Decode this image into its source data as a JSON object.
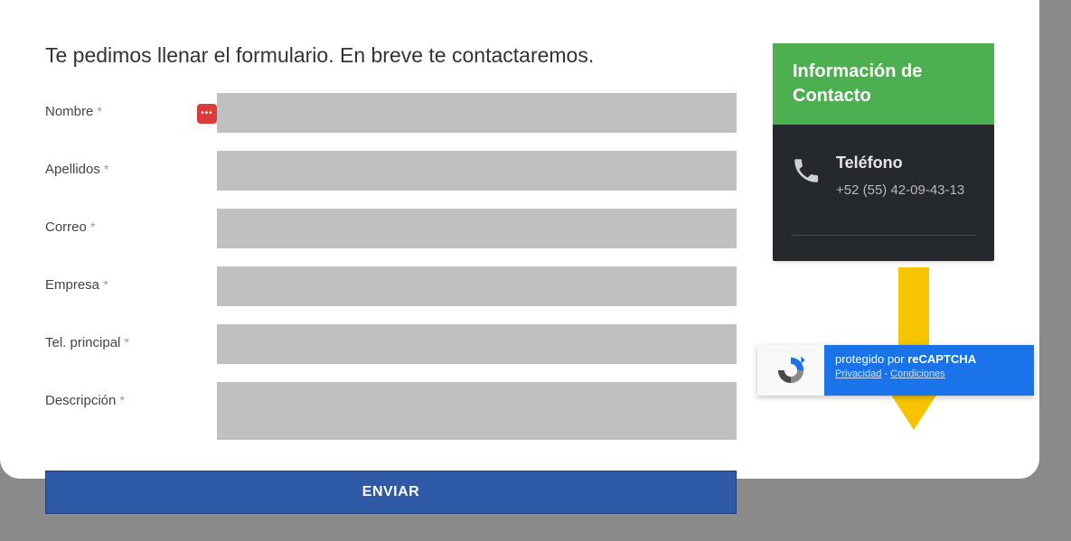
{
  "form": {
    "title": "Te pedimos llenar el formulario. En breve te contactaremos.",
    "required_marker": "*",
    "fields": {
      "nombre": {
        "label": "Nombre",
        "value": ""
      },
      "apellidos": {
        "label": "Apellidos",
        "value": ""
      },
      "correo": {
        "label": "Correo",
        "value": ""
      },
      "empresa": {
        "label": "Empresa",
        "value": ""
      },
      "tel": {
        "label": "Tel. principal",
        "value": ""
      },
      "descripcion": {
        "label": "Descripción",
        "value": ""
      }
    },
    "submit_label": "ENVIAR"
  },
  "contact_card": {
    "header": "Información de Contacto",
    "phone_heading": "Teléfono",
    "phone_value": "+52 (55) 42-09-43-13"
  },
  "recaptcha": {
    "protected_prefix": "protegido por ",
    "brand": "reCAPTCHA",
    "privacy": "Privacidad",
    "dash": " - ",
    "terms": "Condiciones"
  },
  "icons": {
    "password_dots": "•••"
  },
  "colors": {
    "accent_green": "#4caf50",
    "submit_blue": "#2e5aa8",
    "arrow_yellow": "#f6c400",
    "recaptcha_blue": "#1a73e8"
  }
}
